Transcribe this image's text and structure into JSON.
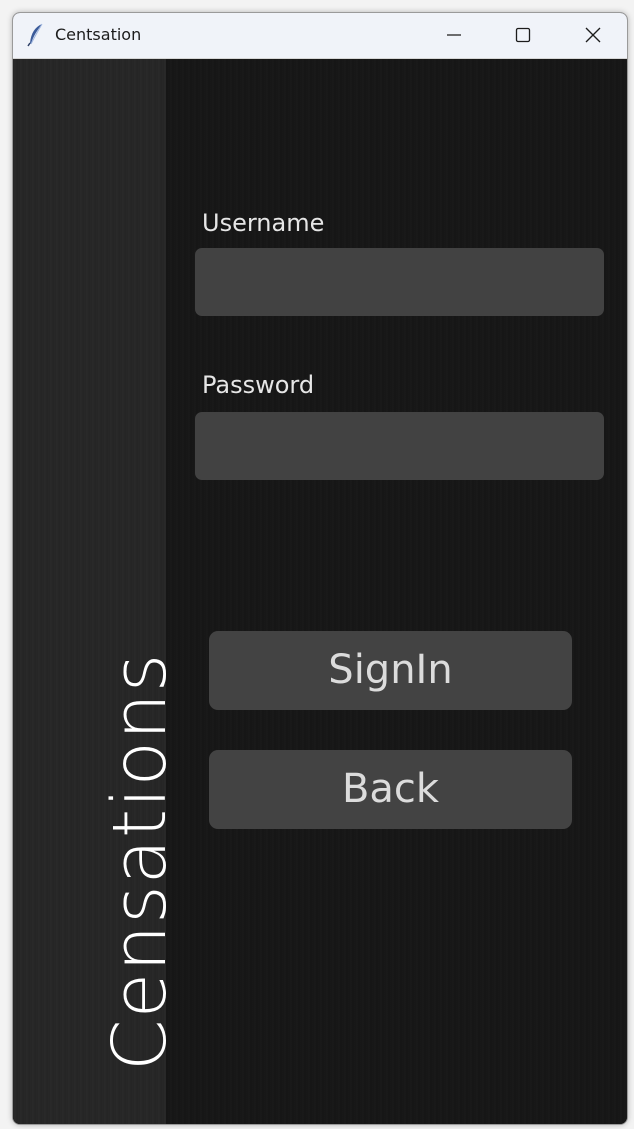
{
  "window": {
    "title": "Centsation",
    "app_icon": "feather-icon",
    "controls": {
      "minimize_icon": "minimize-icon",
      "maximize_icon": "maximize-icon",
      "close_icon": "close-icon"
    }
  },
  "sidebar": {
    "title": "Censations"
  },
  "form": {
    "username_label": "Username",
    "username_value": "",
    "password_label": "Password",
    "password_value": ""
  },
  "buttons": {
    "signin_label": "SignIn",
    "back_label": "Back"
  },
  "colors": {
    "background": "#171717",
    "sidebar": "#262626",
    "field": "#424242",
    "button": "#434343",
    "text": "#e6e6e6",
    "titlebar": "#f0f3f9"
  }
}
